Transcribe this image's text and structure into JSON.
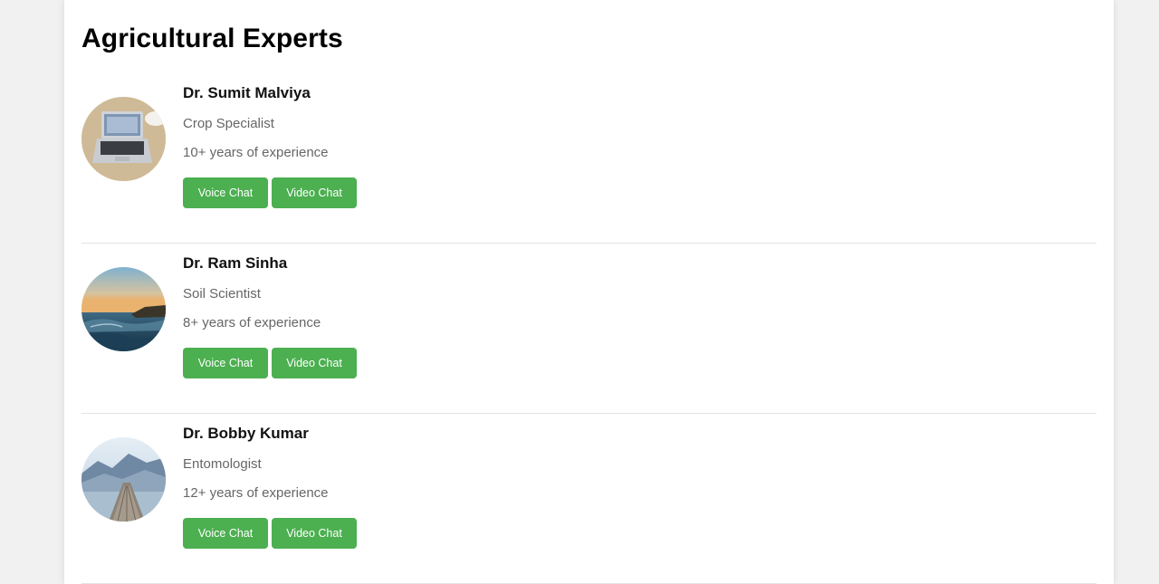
{
  "page": {
    "title": "Agricultural Experts"
  },
  "experts": [
    {
      "name": "Dr. Sumit Malviya",
      "specialty": "Crop Specialist",
      "experience": "10+ years of experience",
      "voice_label": "Voice Chat",
      "video_label": "Video Chat",
      "avatar_icon": "laptop-photo-icon"
    },
    {
      "name": "Dr. Ram Sinha",
      "specialty": "Soil Scientist",
      "experience": "8+ years of experience",
      "voice_label": "Voice Chat",
      "video_label": "Video Chat",
      "avatar_icon": "ocean-sunset-photo-icon"
    },
    {
      "name": "Dr. Bobby Kumar",
      "specialty": "Entomologist",
      "experience": "12+ years of experience",
      "voice_label": "Voice Chat",
      "video_label": "Video Chat",
      "avatar_icon": "mountain-pier-photo-icon"
    }
  ],
  "colors": {
    "button_bg": "#4caf50",
    "page_bg": "#f1f1f1",
    "card_bg": "#ffffff"
  }
}
